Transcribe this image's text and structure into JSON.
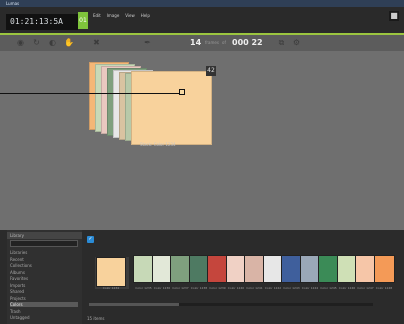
{
  "window": {
    "title": "Lumas"
  },
  "header": {
    "logo_text": "01:21:13:5A",
    "logo_badge": "01",
    "menu": [
      "Edit",
      "Image",
      "View",
      "Help"
    ],
    "window_button": "■",
    "accent": "#9bc53f"
  },
  "toolbar": {
    "tools": [
      {
        "name": "select-icon",
        "glyph": "◉"
      },
      {
        "name": "rotate-icon",
        "glyph": "↻"
      },
      {
        "name": "flip-icon",
        "glyph": "◐"
      },
      {
        "name": "hand-icon",
        "glyph": "✋"
      },
      {
        "name": "marker-icon",
        "glyph": "✖"
      },
      {
        "name": "brush-icon",
        "glyph": "✒"
      }
    ],
    "frame_number": "14",
    "frame_label": "frames",
    "total_number": "000 22",
    "total_label": "of",
    "zoom_glyph": "⧉",
    "settings_glyph": "⚙"
  },
  "stack": {
    "badge": "42",
    "caption": "Stack: Color 1234",
    "card_colors": [
      "#f4b777",
      "#c7d9b7",
      "#e9c8c0",
      "#7fa07e",
      "#e7e7e7",
      "#d9c3a1",
      "#b8c9a9",
      "#f8d29c"
    ]
  },
  "sidebar": {
    "header": "Library",
    "rows": [
      {
        "label": "Libraries",
        "selected": false
      },
      {
        "label": "Recent",
        "selected": false
      },
      {
        "label": "Collections",
        "selected": false
      },
      {
        "label": "Albums",
        "selected": false
      },
      {
        "label": "Favorites",
        "selected": false
      },
      {
        "label": "Imports",
        "selected": false
      },
      {
        "label": "Shared",
        "selected": false
      },
      {
        "label": "Projects",
        "selected": false
      },
      {
        "label": "Colors",
        "selected": true
      },
      {
        "label": "Trash",
        "selected": false
      },
      {
        "label": "Untagged",
        "selected": false
      }
    ]
  },
  "strip": {
    "check": "✓",
    "items": [
      {
        "color": "#f8d29c",
        "caption": "Color 1234"
      },
      {
        "color": "#c7d9b7",
        "caption": "Color 1235"
      },
      {
        "color": "#e2e8d8",
        "caption": "Color 1236"
      },
      {
        "color": "#7fa07e",
        "caption": "Color 1237"
      },
      {
        "color": "#4e7a62",
        "caption": "Color 1238"
      },
      {
        "color": "#c5463d",
        "caption": "Color 1239"
      },
      {
        "color": "#f0d1c5",
        "caption": "Color 1240"
      },
      {
        "color": "#d9b4a6",
        "caption": "Color 1241"
      },
      {
        "color": "#e7e7e7",
        "caption": "Color 1242"
      },
      {
        "color": "#3f5f9c",
        "caption": "Color 1243"
      },
      {
        "color": "#9aa8b8",
        "caption": "Color 1244"
      },
      {
        "color": "#3b8b57",
        "caption": "Color 1245"
      },
      {
        "color": "#cfe0b6",
        "caption": "Color 1246"
      },
      {
        "color": "#f6c6a8",
        "caption": "Color 1247"
      },
      {
        "color": "#f49a57",
        "caption": "Color 1248"
      }
    ]
  },
  "status": {
    "text": "15 items"
  }
}
